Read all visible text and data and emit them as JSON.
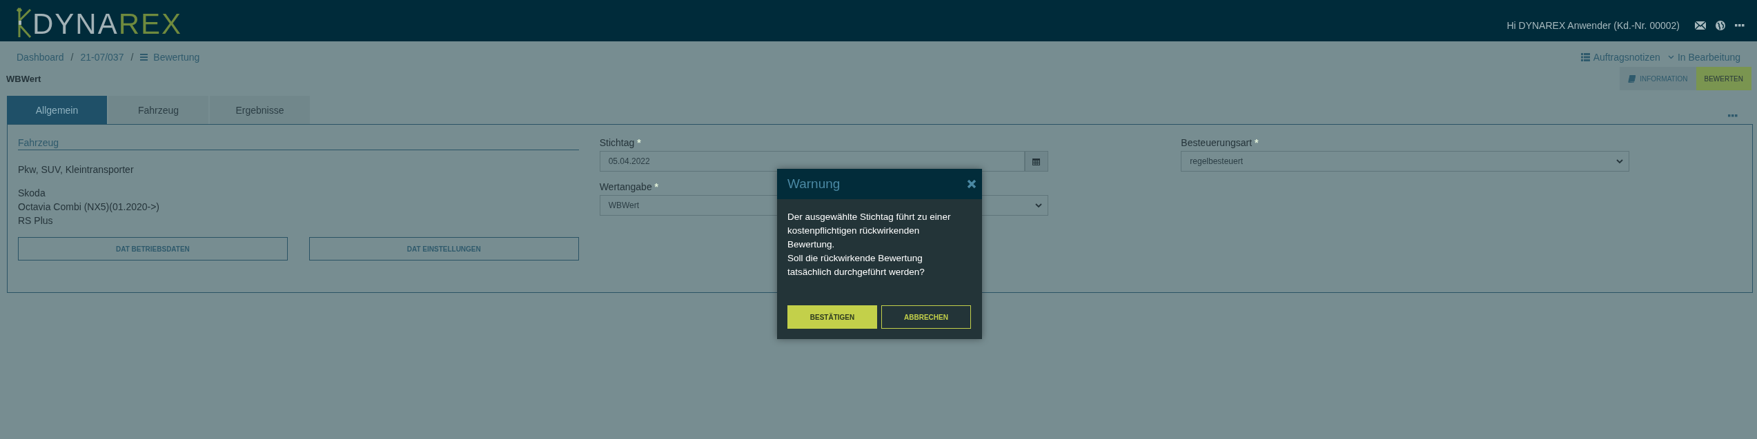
{
  "header": {
    "logo": {
      "part_1": "DYNA",
      "part_2": "REX"
    },
    "greeting": "Hi DYNAREX Anwender (Kd.-Nr. 00002)"
  },
  "breadcrumb": {
    "separator": "/",
    "items": [
      "Dashboard",
      "21-07/037",
      "Bewertung"
    ]
  },
  "page_title": "WBWert",
  "order_links": {
    "notes": "Auftragsnotizen",
    "status": "In Bearbeitung"
  },
  "actions": [
    {
      "label": "INFORMATION",
      "kind": "secondary"
    },
    {
      "label": "BEWERTEN",
      "kind": "primary"
    }
  ],
  "tabs": [
    {
      "label": "Allgemein",
      "selected": true
    },
    {
      "label": "Fahrzeug",
      "selected": false
    },
    {
      "label": "Ergebnisse",
      "selected": false
    }
  ],
  "vehicle": {
    "title": "Fahrzeug",
    "category": "Pkw, SUV, Kleintransporter",
    "details": [
      "Skoda",
      "Octavia Combi (NX5)(01.2020->)",
      "RS Plus"
    ],
    "buttons": [
      "DAT BETRIEBSDATEN",
      "DAT EINSTELLUNGEN"
    ]
  },
  "field_columns": [
    [
      {
        "label": "Stichtag",
        "required_mark": "*",
        "value": "05.04.2022",
        "kind": "date"
      },
      {
        "label": "Wertangabe",
        "required_mark": "*",
        "value": "WBWert",
        "kind": "select"
      }
    ],
    [
      {
        "label": "Besteuerungsart",
        "required_mark": "*",
        "value": "regelbesteuert",
        "kind": "select"
      }
    ]
  ],
  "dialog": {
    "title": "Warnung",
    "paragraphs": [
      "Der ausgewählte Stichtag führt zu einer kostenpflichtigen rückwirkenden Bewertung.",
      "Soll die rückwirkende Bewertung tatsächlich durchgeführt werden?"
    ],
    "buttons": [
      {
        "label": "BESTÄTIGEN",
        "kind": "primary"
      },
      {
        "label": "ABBRECHEN",
        "kind": "secondary"
      }
    ]
  }
}
